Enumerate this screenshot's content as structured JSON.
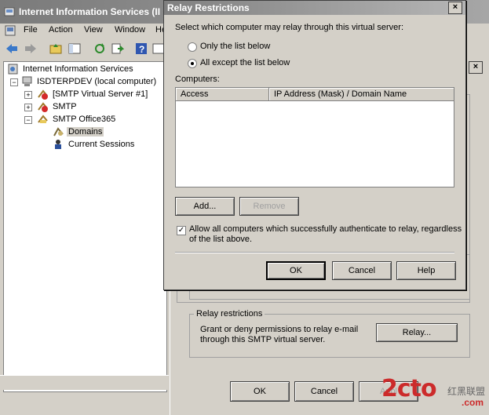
{
  "iis": {
    "title": "Internet Information Services (II",
    "menu": [
      "File",
      "Action",
      "View",
      "Window",
      "He"
    ],
    "tree": {
      "root": "Internet Information Services",
      "computer": "ISDTERPDEV (local computer)",
      "items": [
        "[SMTP Virtual Server #1]",
        "SMTP",
        "SMTP Office365",
        "Domains",
        "Current Sessions"
      ]
    }
  },
  "props": {
    "close": "×",
    "relay_group_title": "Relay restrictions",
    "relay_group_text_1": "Grant or deny permissions to relay e-mail",
    "relay_group_text_2": "through this SMTP virtual server.",
    "relay_button": "Relay...",
    "ok": "OK",
    "cancel": "Cancel",
    "apply": "Appl"
  },
  "relay": {
    "title": "Relay Restrictions",
    "close": "×",
    "prompt": "Select which computer may relay through this virtual server:",
    "radio_only": "Only the list below",
    "radio_all": "All except the list below",
    "selected": "all",
    "computers_label": "Computers:",
    "columns": [
      "Access",
      "IP Address (Mask) / Domain Name"
    ],
    "add": "Add...",
    "remove": "Remove",
    "allow_auth_1": "Allow all computers which successfully authenticate to relay, regardless",
    "allow_auth_2": "of the list above.",
    "allow_auth_checked": true,
    "ok": "OK",
    "cancel": "Cancel",
    "help": "Help"
  },
  "watermark": {
    "brand": "2cto",
    "sub": "红黑联盟",
    "domain": ".com"
  }
}
